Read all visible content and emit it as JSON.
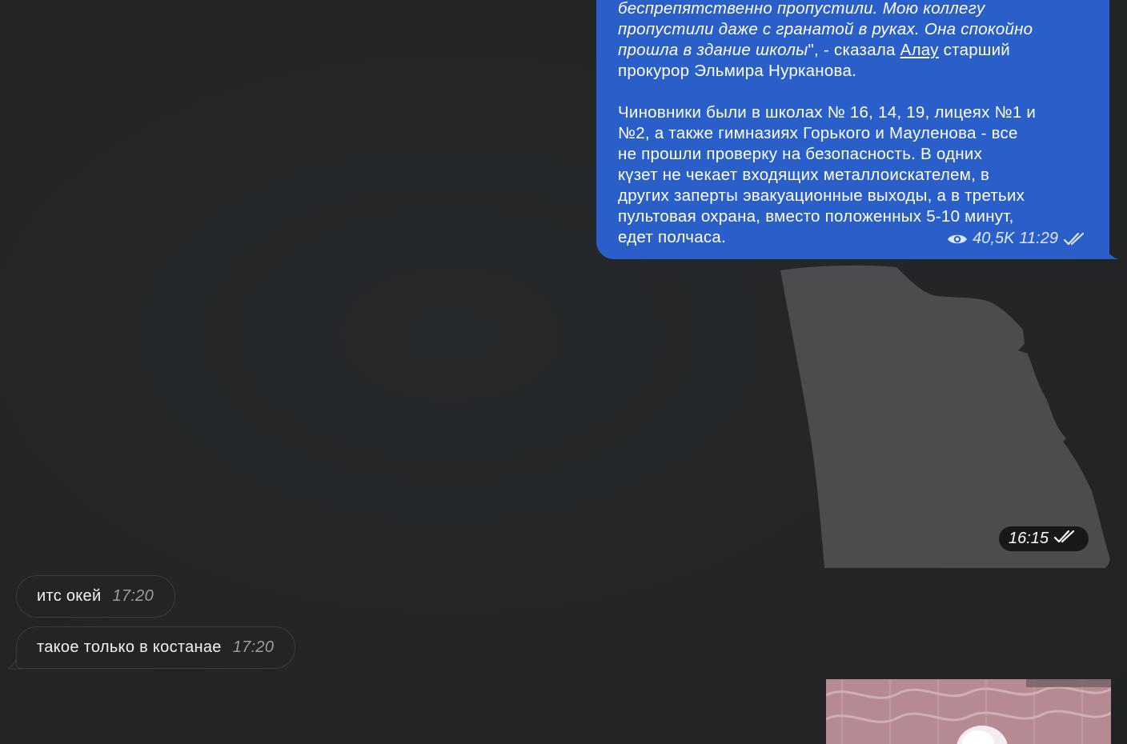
{
  "post": {
    "quote_text": "беспрепятственно пропустили. Мою коллегу\nпропустили даже с гранатой в руках. Она спокойно\nпрошла в здание школы",
    "after_quote": "\", - сказала ",
    "link_text": "Алау",
    "after_link": " старший\nпрокурор Эльмира Нурканова.",
    "paragraph2": "Чиновники были в школах № 16, 14, 19, лицеях №1 и\n№2, а также гимназиях Горького и Мауленова - все\nне прошли проверку на безопасность. В одних\nкүзет не чекает входящих металлоискателем, в\nдругих заперты эвакуационные выходы, а в третьих\nпультовая охрана, вместо положенных 5-10 минут,\nедет полчаса.",
    "views": "40,5K",
    "time": "11:29",
    "status_icon": "double-check-icon",
    "views_icon": "eye-icon"
  },
  "sticker": {
    "time": "16:15",
    "status_icon": "double-check-icon"
  },
  "messages": [
    {
      "text": "итс окей",
      "time": "17:20"
    },
    {
      "text": "такое только в костанае",
      "time": "17:20"
    }
  ],
  "colors": {
    "background": "#232527",
    "outgoing_bubble": "#2a5ec8",
    "incoming_bubble": "#222426",
    "sticker": "#4a4c4e"
  }
}
